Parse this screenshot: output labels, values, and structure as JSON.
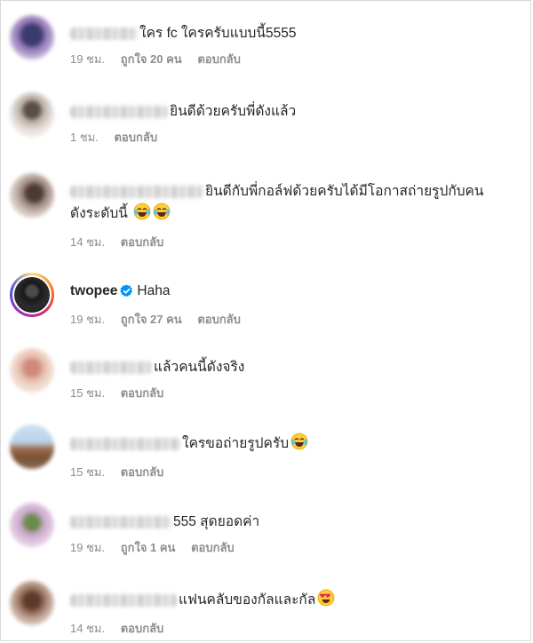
{
  "comments": [
    {
      "username": "",
      "text": "ใคร fc ใครครับแบบนี้5555",
      "time": "19 ชม.",
      "likes": "ถูกใจ 20 คน",
      "reply": "ตอบกลับ"
    },
    {
      "username": "",
      "text": "ยินดีด้วยครับพี่ดังแล้ว",
      "time": "1 ชม.",
      "likes": "",
      "reply": "ตอบกลับ"
    },
    {
      "username": "",
      "text": "ยินดีกับพี่กอล์ฟด้วยครับได้มีโอกาสถ่ายรูปกับคน",
      "text2": "ดังระดับนี้",
      "time": "14 ชม.",
      "likes": "",
      "reply": "ตอบกลับ"
    },
    {
      "username": "twopee",
      "text": "Haha",
      "time": "19 ชม.",
      "likes": "ถูกใจ 27 คน",
      "reply": "ตอบกลับ"
    },
    {
      "username": "",
      "text": "แล้วคนนี้ดังจริง",
      "time": "15 ชม.",
      "likes": "",
      "reply": "ตอบกลับ"
    },
    {
      "username": "",
      "text": "ใครขอถ่ายรูปครับ",
      "time": "15 ชม.",
      "likes": "",
      "reply": "ตอบกลับ"
    },
    {
      "username": "",
      "text": "555 สุดยอดค่า",
      "time": "19 ชม.",
      "likes": "ถูกใจ 1 คน",
      "reply": "ตอบกลับ"
    },
    {
      "username": "",
      "text": "แฟนคลับของกัลและกัล",
      "time": "14 ชม.",
      "likes": "",
      "reply": "ตอบกลับ"
    }
  ],
  "icons": {
    "verified": "verified-badge-icon",
    "laughing": "tears-of-joy-emoji",
    "heart_eyes": "heart-eyes-emoji"
  },
  "colors": {
    "verified": "#0095f6",
    "meta": "#8e8e8e",
    "text": "#262626"
  }
}
